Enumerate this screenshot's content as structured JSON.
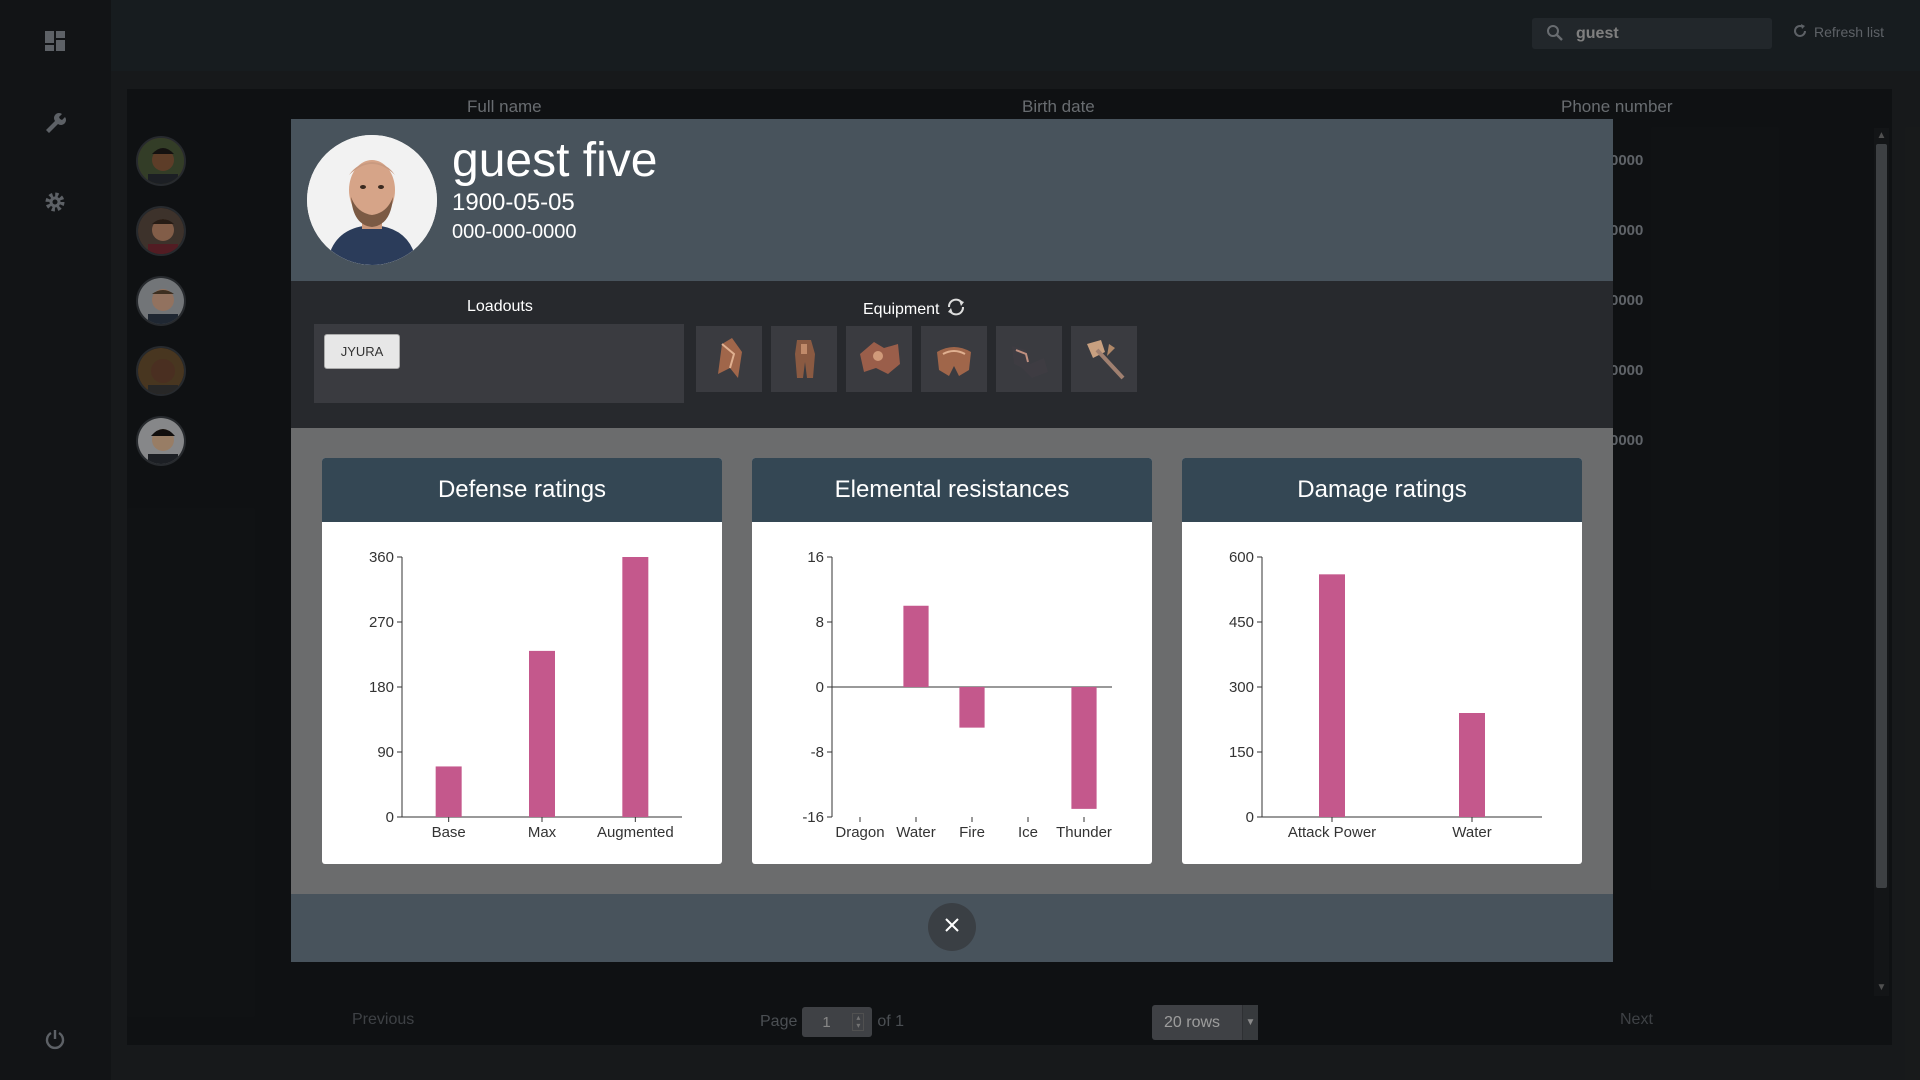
{
  "search": {
    "value": "guest",
    "icon": "search-icon"
  },
  "toolbar": {
    "refresh_label": "Refresh list"
  },
  "sidebar": {
    "items": [
      "dashboard-icon",
      "wrench-icon",
      "gear-icon",
      "power-icon"
    ]
  },
  "table": {
    "columns": [
      "Full name",
      "Birth date",
      "Phone number"
    ],
    "phone_fragments": [
      "0000",
      "0000",
      "0000",
      "0000",
      "0000"
    ]
  },
  "pagination": {
    "previous": "Previous",
    "page_label": "Page",
    "page_value": "1",
    "of_label": "of 1",
    "rows": "20 rows",
    "next": "Next"
  },
  "modal": {
    "name": "guest five",
    "birth_date": "1900-05-05",
    "phone": "000-000-0000",
    "loadouts_title": "Loadouts",
    "loadout_button": "JYURA",
    "equipment_title": "Equipment",
    "equipment_slots": [
      "helm-icon",
      "chest-icon",
      "arms-icon",
      "waist-icon",
      "legs-icon",
      "weapon-icon"
    ]
  },
  "chart_data": [
    {
      "type": "bar",
      "title": "Defense ratings",
      "categories": [
        "Base",
        "Max",
        "Augmented"
      ],
      "values": [
        70,
        230,
        360
      ],
      "ylim": [
        0,
        360
      ],
      "yticks": [
        0,
        90,
        180,
        270,
        360
      ],
      "color": "#c4588c"
    },
    {
      "type": "bar",
      "title": "Elemental resistances",
      "categories": [
        "Dragon",
        "Water",
        "Fire",
        "Ice",
        "Thunder"
      ],
      "values": [
        0,
        10,
        -5,
        0,
        -15
      ],
      "ylim": [
        -16,
        16
      ],
      "yticks": [
        -16,
        -8,
        0,
        8,
        16
      ],
      "color": "#c4588c"
    },
    {
      "type": "bar",
      "title": "Damage ratings",
      "categories": [
        "Attack Power",
        "Water"
      ],
      "values": [
        560,
        240
      ],
      "ylim": [
        0,
        600
      ],
      "yticks": [
        0,
        150,
        300,
        450,
        600
      ],
      "color": "#c4588c"
    }
  ]
}
